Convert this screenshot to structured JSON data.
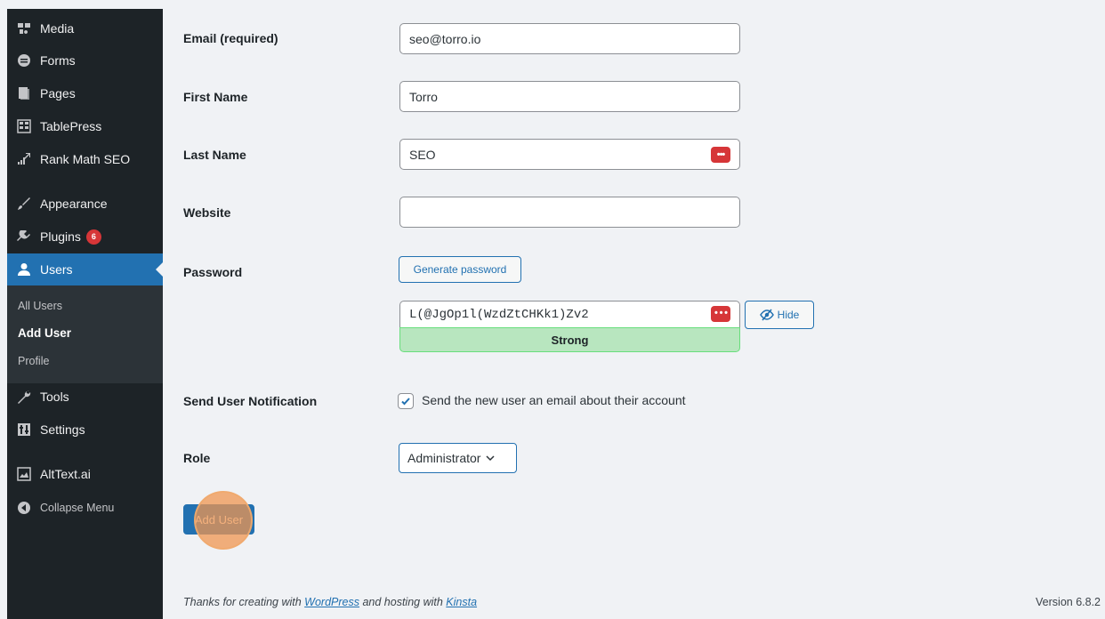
{
  "sidebar": {
    "items": [
      {
        "label": "Media",
        "icon": "media-icon"
      },
      {
        "label": "Forms",
        "icon": "forms-icon"
      },
      {
        "label": "Pages",
        "icon": "pages-icon"
      },
      {
        "label": "TablePress",
        "icon": "tablepress-icon"
      },
      {
        "label": "Rank Math SEO",
        "icon": "rank-math-icon"
      },
      {
        "label": "Appearance",
        "icon": "appearance-icon"
      },
      {
        "label": "Plugins",
        "icon": "plugins-icon",
        "badge": "6"
      },
      {
        "label": "Users",
        "icon": "users-icon",
        "active": true
      },
      {
        "label": "Tools",
        "icon": "tools-icon"
      },
      {
        "label": "Settings",
        "icon": "settings-icon"
      },
      {
        "label": "AltText.ai",
        "icon": "alttext-icon"
      },
      {
        "label": "Collapse Menu",
        "icon": "collapse-icon"
      }
    ],
    "submenu": [
      {
        "label": "All Users"
      },
      {
        "label": "Add User",
        "current": true
      },
      {
        "label": "Profile"
      }
    ]
  },
  "form": {
    "email": {
      "label": "Email (required)",
      "value": "seo@torro.io"
    },
    "first_name": {
      "label": "First Name",
      "value": "Torro"
    },
    "last_name": {
      "label": "Last Name",
      "value": "SEO"
    },
    "website": {
      "label": "Website",
      "value": ""
    },
    "password": {
      "label": "Password",
      "generate_label": "Generate password",
      "value": "L(@JgOp1l(WzdZtCHKk1)Zv2",
      "strength": "Strong",
      "hide_label": "Hide"
    },
    "notification": {
      "label": "Send User Notification",
      "checkbox_label": "Send the new user an email about their account",
      "checked": true
    },
    "role": {
      "label": "Role",
      "selected": "Administrator"
    },
    "submit_label": "Add User"
  },
  "footer": {
    "text_prefix": "Thanks for creating with ",
    "link1": "WordPress",
    "text_middle": " and hosting with ",
    "link2": "Kinsta",
    "version": "Version 6.8.2"
  },
  "colors": {
    "sidebar_bg": "#1d2327",
    "accent": "#2271b1",
    "badge": "#d63638",
    "strength_bg": "#b8e6bf"
  }
}
